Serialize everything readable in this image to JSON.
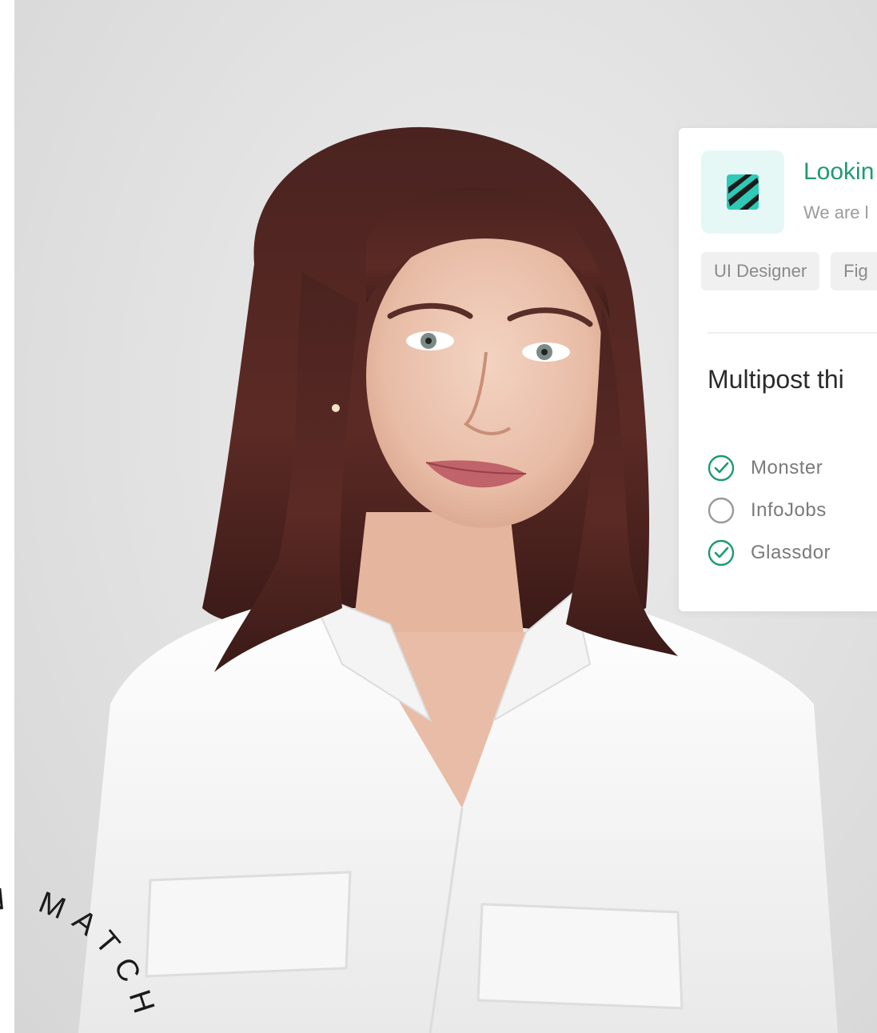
{
  "job_card": {
    "title": "Lookin",
    "description": "We are l",
    "tags": [
      "UI Designer",
      "Fig"
    ],
    "multipost_title": "Multipost thi",
    "options": [
      {
        "label": "Monster",
        "checked": true
      },
      {
        "label": "InfoJobs",
        "checked": false
      },
      {
        "label": "Glassdor",
        "checked": true
      }
    ],
    "colors": {
      "accent": "#1e9a72",
      "logo_bg": "#e6f8f6",
      "tag_bg": "#f0f0f0"
    }
  },
  "watermark": {
    "text": "N MATCH"
  },
  "photo": {
    "icon": "portrait-photo"
  }
}
